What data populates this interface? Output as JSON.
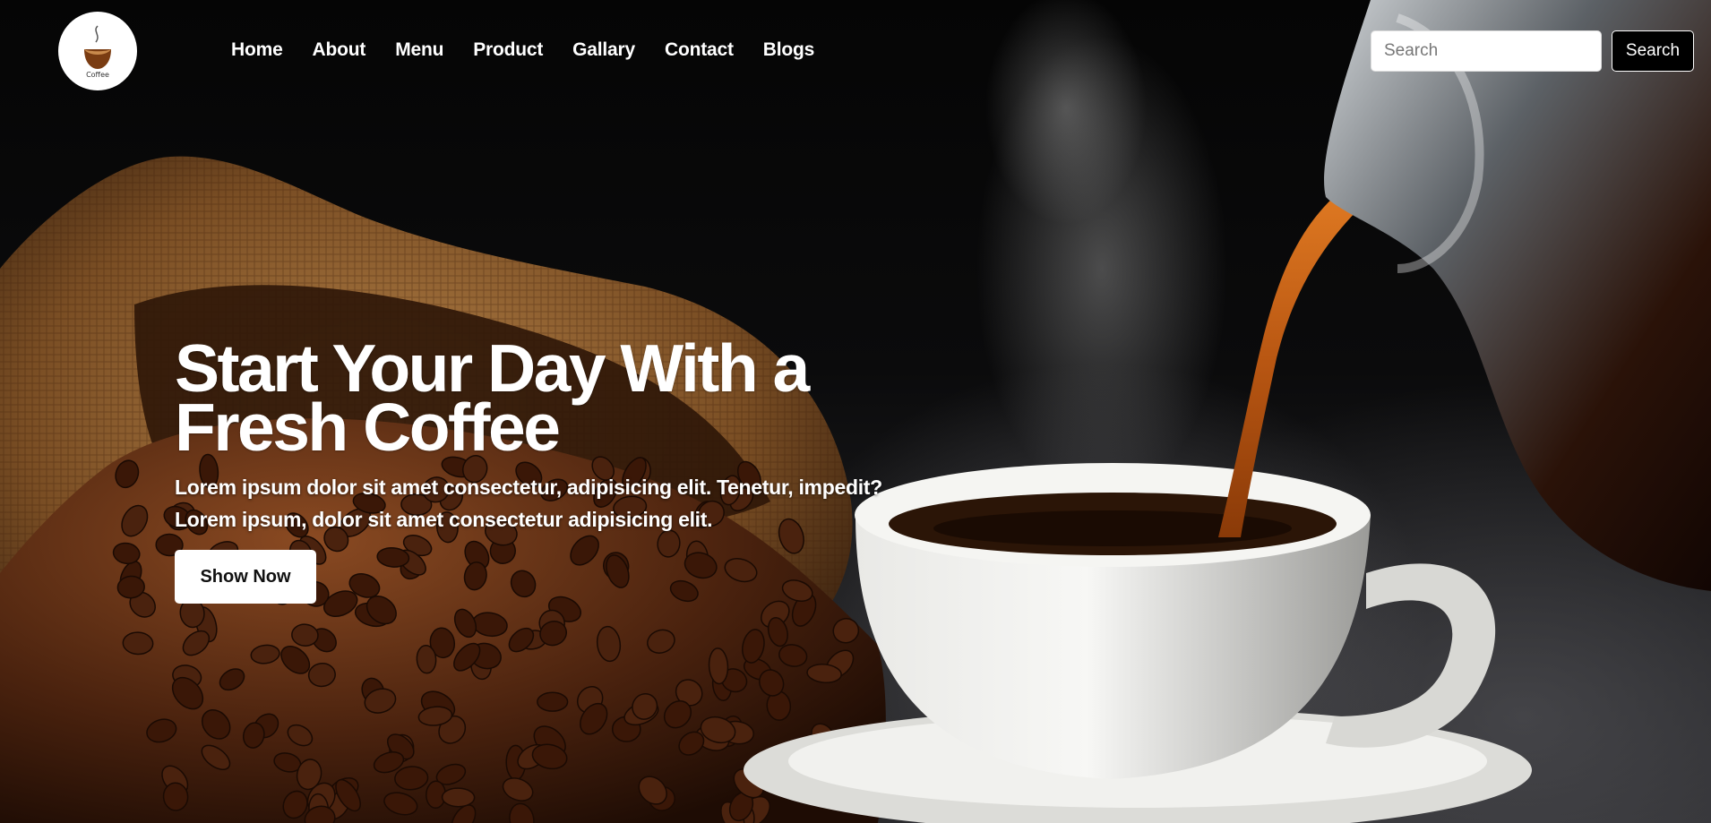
{
  "brand": {
    "logo_text": "Coffee"
  },
  "nav": {
    "items": [
      {
        "label": "Home"
      },
      {
        "label": "About"
      },
      {
        "label": "Menu"
      },
      {
        "label": "Product"
      },
      {
        "label": "Gallary"
      },
      {
        "label": "Contact"
      },
      {
        "label": "Blogs"
      }
    ]
  },
  "search": {
    "placeholder": "Search",
    "value": "",
    "button_label": "Search"
  },
  "hero": {
    "title": "Start Your Day With a Fresh Coffee",
    "text": "Lorem ipsum dolor sit amet consectetur, adipisicing elit. Tenetur, impedit? Lorem ipsum, dolor sit amet consectetur adipisicing elit.",
    "button_label": "Show Now",
    "background_image": "coffee-beans-sack-and-cup-photo"
  },
  "colors": {
    "background": "#000000",
    "text": "#ffffff",
    "burlap": "#a0703a",
    "bean": "#5a2e14",
    "coffee_stream": "#c9661a"
  }
}
